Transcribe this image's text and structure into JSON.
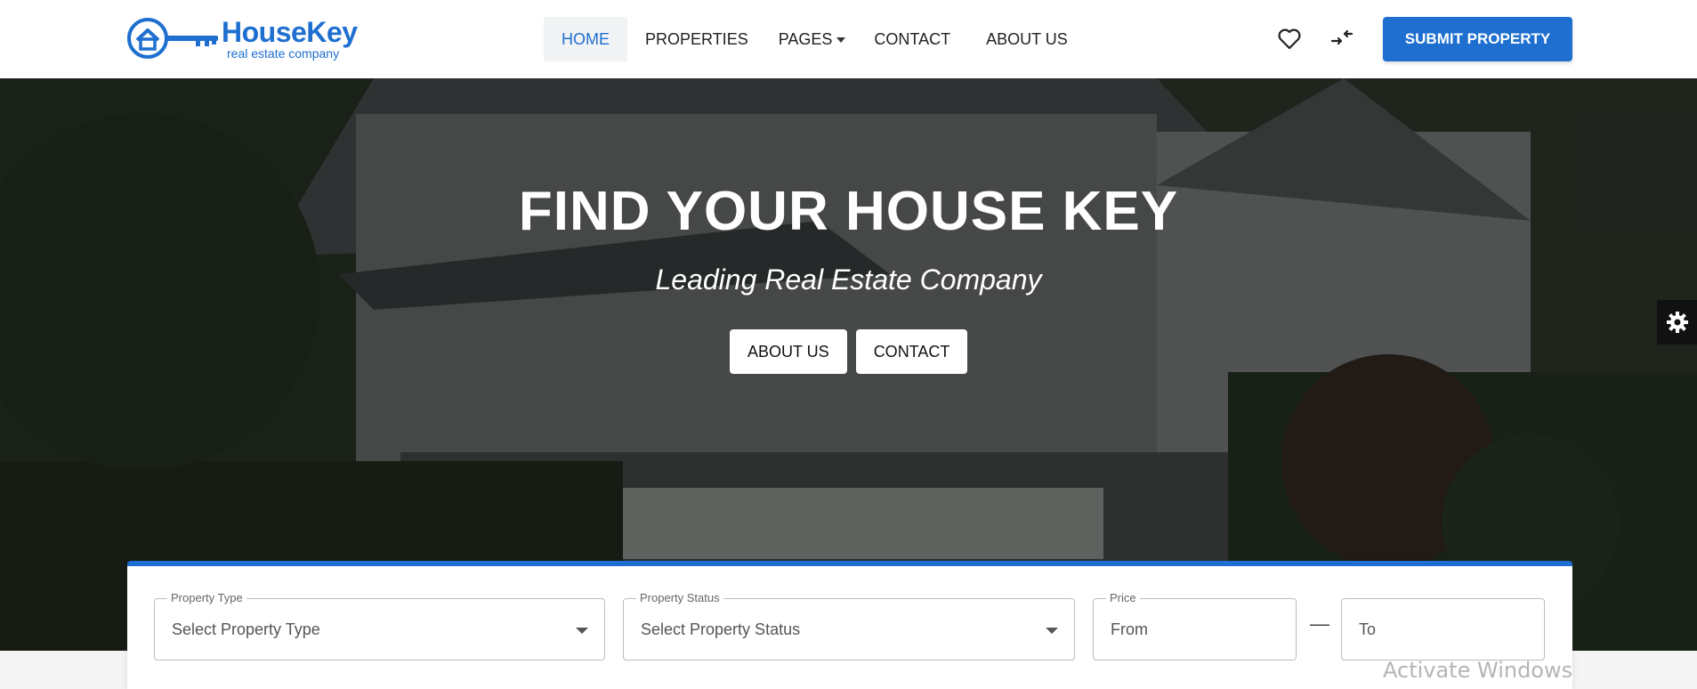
{
  "header": {
    "logo": {
      "title": "HouseKey",
      "subtitle": "real estate company"
    },
    "nav": [
      {
        "label": "HOME",
        "active": true
      },
      {
        "label": "PROPERTIES"
      },
      {
        "label": "PAGES",
        "has_dropdown": true
      },
      {
        "label": "CONTACT"
      },
      {
        "label": "ABOUT US"
      }
    ],
    "icons": [
      "heart-icon",
      "compare-icon"
    ],
    "submit_label": "SUBMIT PROPERTY"
  },
  "hero": {
    "title": "FIND YOUR HOUSE KEY",
    "subtitle": "Leading Real Estate Company",
    "buttons": [
      "ABOUT US",
      "CONTACT"
    ]
  },
  "search": {
    "property_type": {
      "label": "Property Type",
      "value": "Select Property Type"
    },
    "property_status": {
      "label": "Property Status",
      "value": "Select Property Status"
    },
    "price": {
      "label": "Price",
      "from_placeholder": "From",
      "to_placeholder": "To",
      "separator": "—"
    }
  },
  "watermark": "Activate Windows",
  "colors": {
    "accent": "#1e6fd0"
  }
}
